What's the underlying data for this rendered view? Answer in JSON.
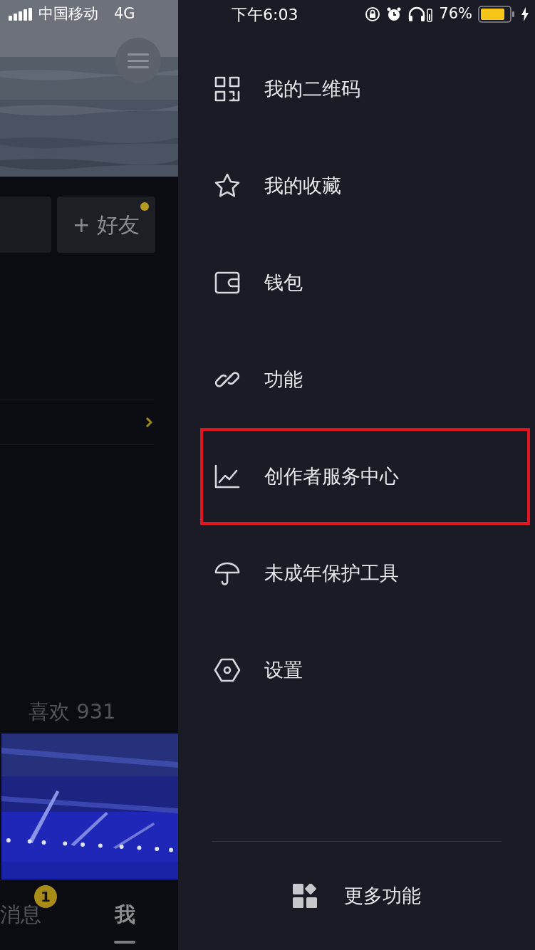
{
  "status_bar": {
    "carrier": "中国移动",
    "network": "4G",
    "time": "下午6:03",
    "battery": "76%"
  },
  "profile": {
    "add_friend": "+ 好友",
    "add_friend_dot": true,
    "likes": "喜欢 931"
  },
  "tab_bar": [
    {
      "label": "消息",
      "badge": "1",
      "selected": false
    },
    {
      "label": "我",
      "selected": true
    }
  ],
  "menu": {
    "items": [
      {
        "label": "我的二维码",
        "highlighted": false
      },
      {
        "label": "我的收藏",
        "highlighted": false
      },
      {
        "label": "钱包",
        "highlighted": false
      },
      {
        "label": "功能",
        "highlighted": false
      },
      {
        "label": "创作者服务中心",
        "highlighted": true
      },
      {
        "label": "未成年保护工具",
        "highlighted": false
      },
      {
        "label": "设置",
        "highlighted": false
      }
    ],
    "more": "更多功能"
  }
}
